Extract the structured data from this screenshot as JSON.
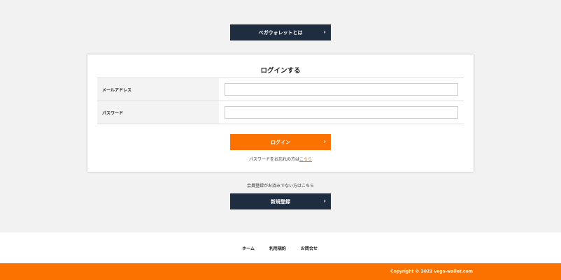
{
  "top": {
    "about_label": "ベガウォレットとは"
  },
  "login": {
    "title": "ログインする",
    "email_label": "メールアドレス",
    "email_value": "",
    "password_label": "パスワード",
    "password_value": "",
    "login_label": "ログイン",
    "forgot_prefix": "パスワードをお忘れの方は",
    "forgot_link": "こちら"
  },
  "register": {
    "note": "会員登録がお済みでない方はこちら",
    "button_label": "新規登録"
  },
  "footer": {
    "links": [
      "ホーム",
      "利用規約",
      "お問合せ"
    ],
    "copyright": "Copyright © 2022 vega-wallet.com"
  },
  "colors": {
    "accent": "#fb7200",
    "dark": "#1e2d40",
    "background": "#f2f2f2"
  },
  "icons": {
    "button_chevron": "chevron-right-icon"
  }
}
